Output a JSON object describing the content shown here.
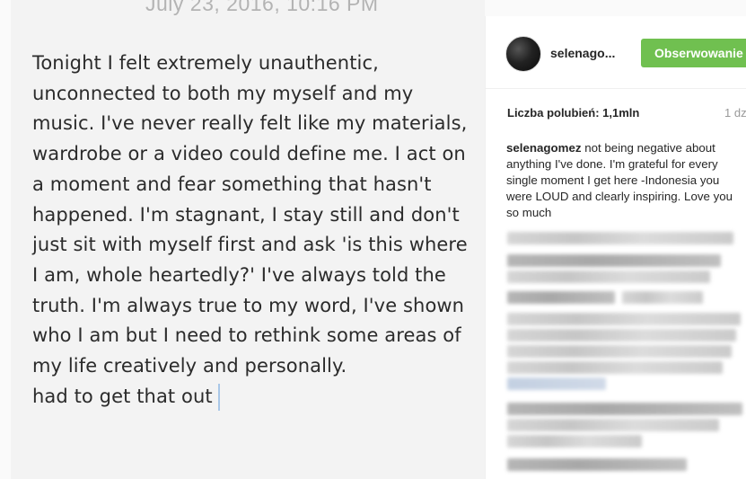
{
  "photo": {
    "date": "July 23, 2016, 10:16 PM",
    "paragraph": "Tonight I felt extremely unauthentic, unconnected to both my myself and my music. I've never really felt like my materials, wardrobe or a video could define me. I act on a moment and fear something that hasn't happened. I'm stagnant, I stay still and don't just sit with myself first and ask 'is this where I am, whole heartedly?' I've always told the truth. I'm always true to my word, I've shown who I am but I need to rethink some areas of my life creatively and personally.",
    "last_line": "had to get that out"
  },
  "post": {
    "username": "selenago...",
    "follow_label": "Obserwowanie",
    "likes": "Liczba polubień: 1,1mln",
    "time": "1 dz",
    "caption_user": "selenagomez",
    "caption_text": "not being negative about anything I've done. I'm grateful for every single moment I get here -Indonesia you were LOUD and clearly inspiring. Love you so much"
  },
  "colors": {
    "follow_button": "#70c050",
    "background": "#fafafa"
  }
}
